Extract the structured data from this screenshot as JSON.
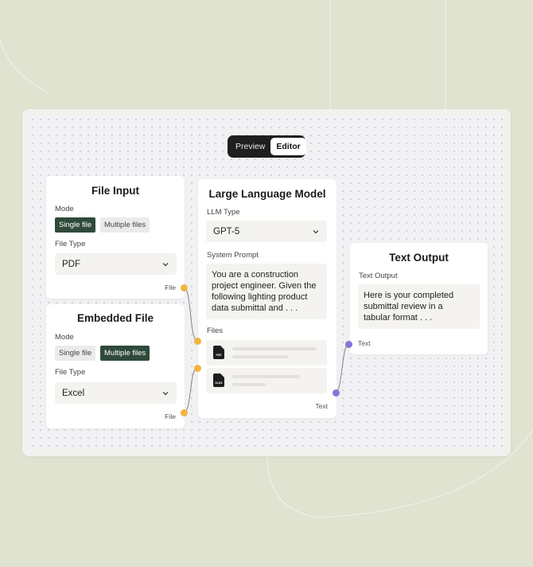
{
  "background": {
    "page_color": "#dfe3cf",
    "canvas_color": "#f1f0f3",
    "accent_dark_green": "#2f4a3a",
    "port_file_color": "#f2b440",
    "port_text_color": "#8079d9"
  },
  "view_toggle": {
    "options": [
      "Preview",
      "Editor"
    ],
    "selected": "Editor"
  },
  "file_input_node": {
    "title": "File Input",
    "mode_label": "Mode",
    "mode_options": [
      "Single file",
      "Multiple files"
    ],
    "mode_selected": "Single file",
    "file_type_label": "File Type",
    "file_type_value": "PDF",
    "output_port_label": "File"
  },
  "embedded_file_node": {
    "title": "Embedded File",
    "mode_label": "Mode",
    "mode_options": [
      "Single file",
      "Multiple files"
    ],
    "mode_selected": "Multiple files",
    "file_type_label": "File Type",
    "file_type_value": "Excel",
    "output_port_label": "File"
  },
  "llm_node": {
    "title": "Large Language Model",
    "llm_type_label": "LLM Type",
    "llm_type_value": "GPT-5",
    "system_prompt_label": "System Prompt",
    "system_prompt_lines": [
      "You are a construction",
      "project engineer. Given the",
      "following lighting product",
      "data submittal and . . ."
    ],
    "files_label": "Files",
    "files": [
      {
        "icon": "pdf-file-icon",
        "badge": "PDF"
      },
      {
        "icon": "xlsx-file-icon",
        "badge": "XLSX"
      }
    ],
    "output_port_label": "Text"
  },
  "text_output_node": {
    "title": "Text Output",
    "field_label": "Text Output",
    "text_lines": [
      "Here is your completed",
      "submittal review in a",
      "tabular format . . ."
    ],
    "input_port_label": "Text"
  }
}
